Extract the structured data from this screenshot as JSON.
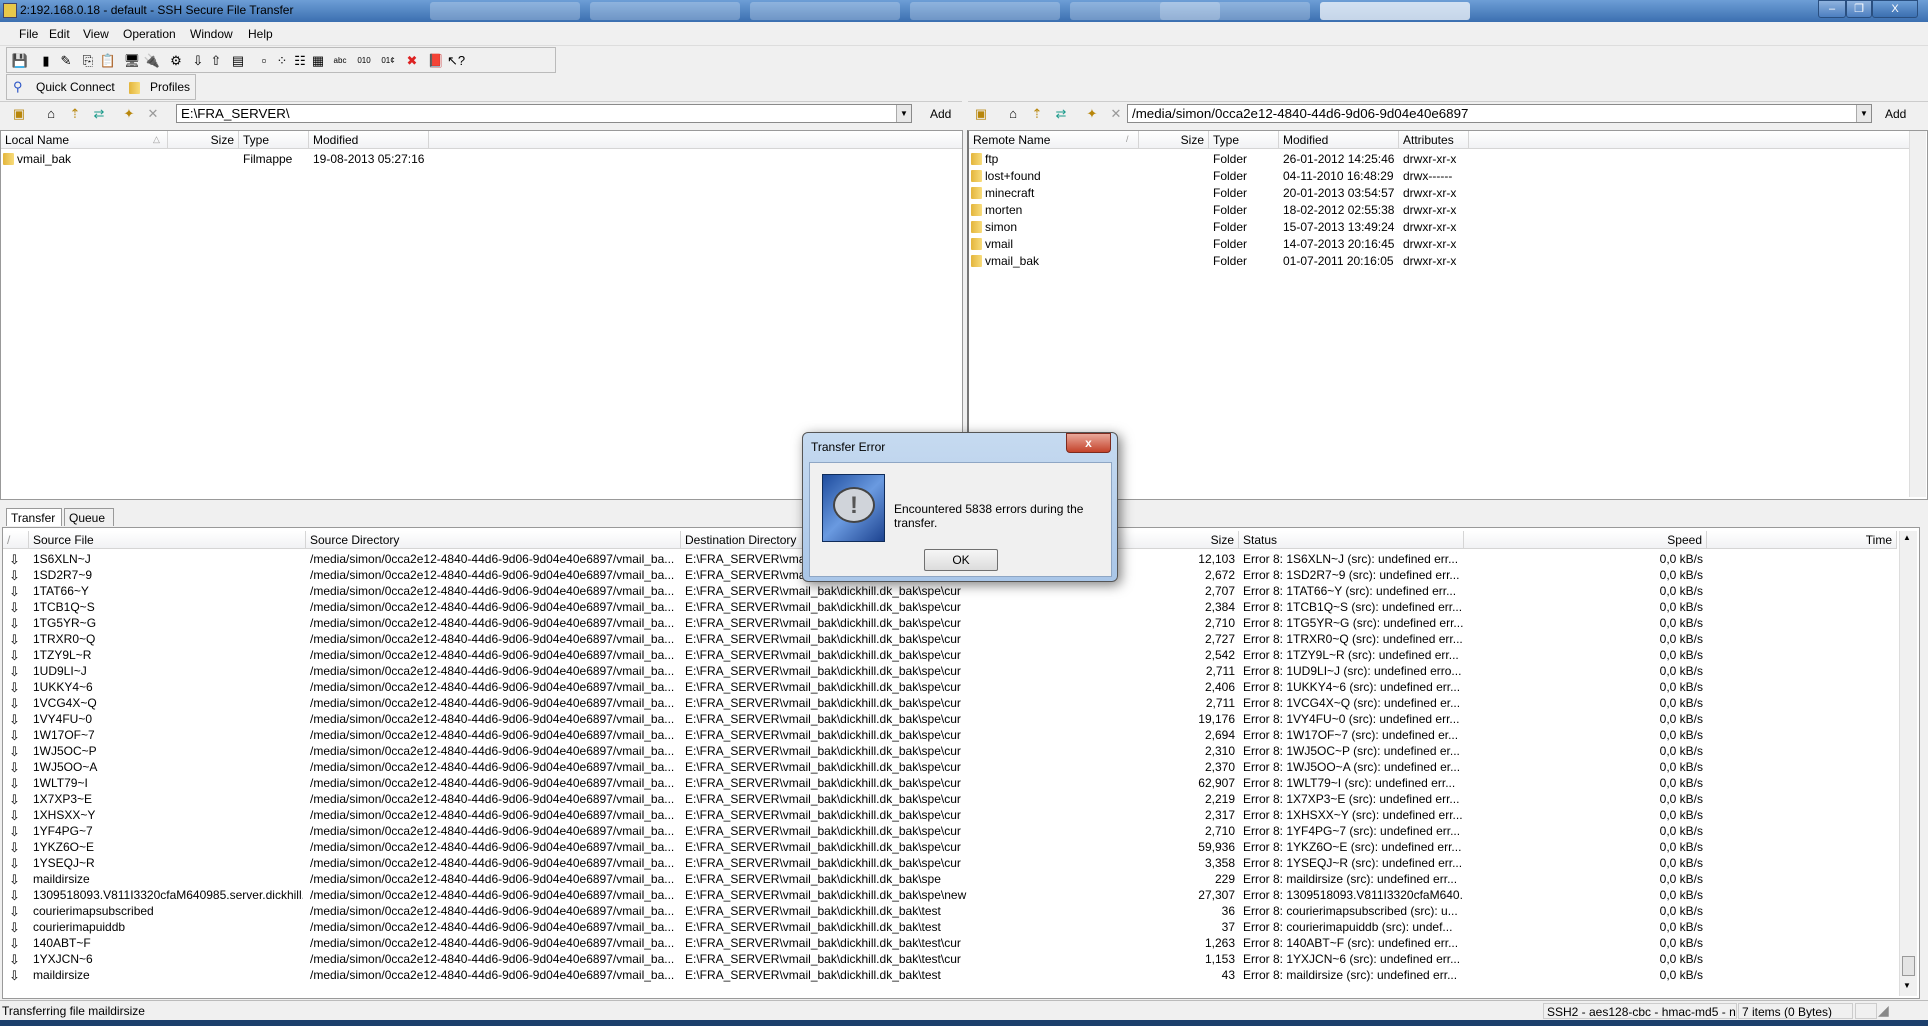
{
  "window": {
    "title": "2:192.168.0.18 - default - SSH Secure File Transfer",
    "minimize": "–",
    "maximize": "❐",
    "close": "X"
  },
  "menu": [
    "File",
    "Edit",
    "View",
    "Operation",
    "Window",
    "Help"
  ],
  "toolbar": [
    "save-icon",
    "disconnect-icon",
    "disconnect-red-icon",
    "copy-icon",
    "paste-icon",
    "new-terminal-icon",
    "connect-icon",
    "settings-icon",
    "download-icon",
    "upload-icon",
    "view-icon",
    "large-icons-icon",
    "small-icons-icon",
    "list-icon",
    "details-icon",
    "ascii-icon",
    "binary-icon",
    "auto-mode-icon",
    "stop-icon",
    "help-book-icon",
    "context-help-icon"
  ],
  "toolbar_glyphs": [
    "💾",
    "▮",
    "✎",
    "⎘",
    "📋",
    "🖥",
    "🔌",
    "⚙",
    "⇩",
    "⇧",
    "▤",
    "▫",
    "⁘",
    "☷",
    "▦",
    "abc",
    "010",
    "01¢",
    "✖",
    "📕",
    "↖?"
  ],
  "quickbar": {
    "quick_connect": "Quick Connect",
    "profiles": "Profiles"
  },
  "local": {
    "path": "E:\\FRA_SERVER\\",
    "add": "Add",
    "columns": [
      "Local Name",
      "Size",
      "Type",
      "Modified"
    ],
    "rows": [
      {
        "name": "vmail_bak",
        "size": "",
        "type": "Filmappe",
        "modified": "19-08-2013 05:27:16"
      }
    ]
  },
  "remote": {
    "path": "/media/simon/0cca2e12-4840-44d6-9d06-9d04e40e6897",
    "add": "Add",
    "columns": [
      "Remote Name",
      "Size",
      "Type",
      "Modified",
      "Attributes"
    ],
    "rows": [
      {
        "name": "ftp",
        "size": "",
        "type": "Folder",
        "modified": "26-01-2012 14:25:46",
        "attr": "drwxr-xr-x"
      },
      {
        "name": "lost+found",
        "size": "",
        "type": "Folder",
        "modified": "04-11-2010 16:48:29",
        "attr": "drwx------"
      },
      {
        "name": "minecraft",
        "size": "",
        "type": "Folder",
        "modified": "20-01-2013 03:54:57",
        "attr": "drwxr-xr-x"
      },
      {
        "name": "morten",
        "size": "",
        "type": "Folder",
        "modified": "18-02-2012 02:55:38",
        "attr": "drwxr-xr-x"
      },
      {
        "name": "simon",
        "size": "",
        "type": "Folder",
        "modified": "15-07-2013 13:49:24",
        "attr": "drwxr-xr-x"
      },
      {
        "name": "vmail",
        "size": "",
        "type": "Folder",
        "modified": "14-07-2013 20:16:45",
        "attr": "drwxr-xr-x"
      },
      {
        "name": "vmail_bak",
        "size": "",
        "type": "Folder",
        "modified": "01-07-2011 20:16:05",
        "attr": "drwxr-xr-x"
      }
    ]
  },
  "tabs": [
    "Transfer",
    "Queue"
  ],
  "transfer": {
    "columns": [
      "Source File",
      "Source Directory",
      "Destination Directory",
      "Size",
      "Status",
      "Speed",
      "Time"
    ],
    "src_dir": "/media/simon/0cca2e12-4840-44d6-9d06-9d04e40e6897/vmail_ba...",
    "rows": [
      {
        "file": "1S6XLN~J",
        "dest": "E:\\FRA_SERVER\\vmail_bak\\dickhill.dk_bak\\spe\\cur",
        "size": "12,103",
        "status": "Error 8: 1S6XLN~J (src): undefined err...",
        "speed": "0,0 kB/s"
      },
      {
        "file": "1SD2R7~9",
        "dest": "E:\\FRA_SERVER\\vmail_bak\\dickhill.dk_bak\\spe\\cur",
        "size": "2,672",
        "status": "Error 8: 1SD2R7~9 (src): undefined err...",
        "speed": "0,0 kB/s"
      },
      {
        "file": "1TAT66~Y",
        "dest": "E:\\FRA_SERVER\\vmail_bak\\dickhill.dk_bak\\spe\\cur",
        "size": "2,707",
        "status": "Error 8: 1TAT66~Y (src): undefined err...",
        "speed": "0,0 kB/s"
      },
      {
        "file": "1TCB1Q~S",
        "dest": "E:\\FRA_SERVER\\vmail_bak\\dickhill.dk_bak\\spe\\cur",
        "size": "2,384",
        "status": "Error 8: 1TCB1Q~S (src): undefined err...",
        "speed": "0,0 kB/s"
      },
      {
        "file": "1TG5YR~G",
        "dest": "E:\\FRA_SERVER\\vmail_bak\\dickhill.dk_bak\\spe\\cur",
        "size": "2,710",
        "status": "Error 8: 1TG5YR~G (src): undefined err...",
        "speed": "0,0 kB/s"
      },
      {
        "file": "1TRXR0~Q",
        "dest": "E:\\FRA_SERVER\\vmail_bak\\dickhill.dk_bak\\spe\\cur",
        "size": "2,727",
        "status": "Error 8: 1TRXR0~Q (src): undefined err...",
        "speed": "0,0 kB/s"
      },
      {
        "file": "1TZY9L~R",
        "dest": "E:\\FRA_SERVER\\vmail_bak\\dickhill.dk_bak\\spe\\cur",
        "size": "2,542",
        "status": "Error 8: 1TZY9L~R (src): undefined err...",
        "speed": "0,0 kB/s"
      },
      {
        "file": "1UD9LI~J",
        "dest": "E:\\FRA_SERVER\\vmail_bak\\dickhill.dk_bak\\spe\\cur",
        "size": "2,711",
        "status": "Error 8: 1UD9LI~J (src): undefined erro...",
        "speed": "0,0 kB/s"
      },
      {
        "file": "1UKKY4~6",
        "dest": "E:\\FRA_SERVER\\vmail_bak\\dickhill.dk_bak\\spe\\cur",
        "size": "2,406",
        "status": "Error 8: 1UKKY4~6 (src): undefined err...",
        "speed": "0,0 kB/s"
      },
      {
        "file": "1VCG4X~Q",
        "dest": "E:\\FRA_SERVER\\vmail_bak\\dickhill.dk_bak\\spe\\cur",
        "size": "2,711",
        "status": "Error 8: 1VCG4X~Q (src): undefined er...",
        "speed": "0,0 kB/s"
      },
      {
        "file": "1VY4FU~0",
        "dest": "E:\\FRA_SERVER\\vmail_bak\\dickhill.dk_bak\\spe\\cur",
        "size": "19,176",
        "status": "Error 8: 1VY4FU~0 (src): undefined err...",
        "speed": "0,0 kB/s"
      },
      {
        "file": "1W17OF~7",
        "dest": "E:\\FRA_SERVER\\vmail_bak\\dickhill.dk_bak\\spe\\cur",
        "size": "2,694",
        "status": "Error 8: 1W17OF~7 (src): undefined er...",
        "speed": "0,0 kB/s"
      },
      {
        "file": "1WJ5OC~P",
        "dest": "E:\\FRA_SERVER\\vmail_bak\\dickhill.dk_bak\\spe\\cur",
        "size": "2,310",
        "status": "Error 8: 1WJ5OC~P (src): undefined er...",
        "speed": "0,0 kB/s"
      },
      {
        "file": "1WJ5OO~A",
        "dest": "E:\\FRA_SERVER\\vmail_bak\\dickhill.dk_bak\\spe\\cur",
        "size": "2,370",
        "status": "Error 8: 1WJ5OO~A (src): undefined er...",
        "speed": "0,0 kB/s"
      },
      {
        "file": "1WLT79~I",
        "dest": "E:\\FRA_SERVER\\vmail_bak\\dickhill.dk_bak\\spe\\cur",
        "size": "62,907",
        "status": "Error 8: 1WLT79~I (src): undefined err...",
        "speed": "0,0 kB/s"
      },
      {
        "file": "1X7XP3~E",
        "dest": "E:\\FRA_SERVER\\vmail_bak\\dickhill.dk_bak\\spe\\cur",
        "size": "2,219",
        "status": "Error 8: 1X7XP3~E (src): undefined err...",
        "speed": "0,0 kB/s"
      },
      {
        "file": "1XHSXX~Y",
        "dest": "E:\\FRA_SERVER\\vmail_bak\\dickhill.dk_bak\\spe\\cur",
        "size": "2,317",
        "status": "Error 8: 1XHSXX~Y (src): undefined err...",
        "speed": "0,0 kB/s"
      },
      {
        "file": "1YF4PG~7",
        "dest": "E:\\FRA_SERVER\\vmail_bak\\dickhill.dk_bak\\spe\\cur",
        "size": "2,710",
        "status": "Error 8: 1YF4PG~7 (src): undefined err...",
        "speed": "0,0 kB/s"
      },
      {
        "file": "1YKZ6O~E",
        "dest": "E:\\FRA_SERVER\\vmail_bak\\dickhill.dk_bak\\spe\\cur",
        "size": "59,936",
        "status": "Error 8: 1YKZ6O~E (src): undefined err...",
        "speed": "0,0 kB/s"
      },
      {
        "file": "1YSEQJ~R",
        "dest": "E:\\FRA_SERVER\\vmail_bak\\dickhill.dk_bak\\spe\\cur",
        "size": "3,358",
        "status": "Error 8: 1YSEQJ~R (src): undefined err...",
        "speed": "0,0 kB/s"
      },
      {
        "file": "maildirsize",
        "dest": "E:\\FRA_SERVER\\vmail_bak\\dickhill.dk_bak\\spe",
        "size": "229",
        "status": "Error 8: maildirsize (src): undefined err...",
        "speed": "0,0 kB/s"
      },
      {
        "file": "1309518093.V811I3320cfaM640985.server.dickhill....",
        "dest": "E:\\FRA_SERVER\\vmail_bak\\dickhill.dk_bak\\spe\\new",
        "size": "27,307",
        "status": "Error 8: 1309518093.V811I3320cfaM640...",
        "speed": "0,0 kB/s"
      },
      {
        "file": "courierimapsubscribed",
        "dest": "E:\\FRA_SERVER\\vmail_bak\\dickhill.dk_bak\\test",
        "size": "36",
        "status": "Error 8: courierimapsubscribed (src): u...",
        "speed": "0,0 kB/s"
      },
      {
        "file": "courierimapuiddb",
        "dest": "E:\\FRA_SERVER\\vmail_bak\\dickhill.dk_bak\\test",
        "size": "37",
        "status": "Error 8: courierimapuiddb (src): undef...",
        "speed": "0,0 kB/s"
      },
      {
        "file": "140ABT~F",
        "dest": "E:\\FRA_SERVER\\vmail_bak\\dickhill.dk_bak\\test\\cur",
        "size": "1,263",
        "status": "Error 8: 140ABT~F (src): undefined err...",
        "speed": "0,0 kB/s"
      },
      {
        "file": "1YXJCN~6",
        "dest": "E:\\FRA_SERVER\\vmail_bak\\dickhill.dk_bak\\test\\cur",
        "size": "1,153",
        "status": "Error 8: 1YXJCN~6 (src): undefined err...",
        "speed": "0,0 kB/s"
      },
      {
        "file": "maildirsize",
        "dest": "E:\\FRA_SERVER\\vmail_bak\\dickhill.dk_bak\\test",
        "size": "43",
        "status": "Error 8: maildirsize (src): undefined err...",
        "speed": "0,0 kB/s"
      }
    ]
  },
  "dialog": {
    "title": "Transfer Error",
    "message": "Encountered 5838 errors during the transfer.",
    "ok": "OK",
    "close": "x"
  },
  "statusbar": {
    "message": "Transferring file maildirsize",
    "connection": "SSH2 - aes128-cbc - hmac-md5 - nc",
    "items": "7 items (0 Bytes)"
  }
}
